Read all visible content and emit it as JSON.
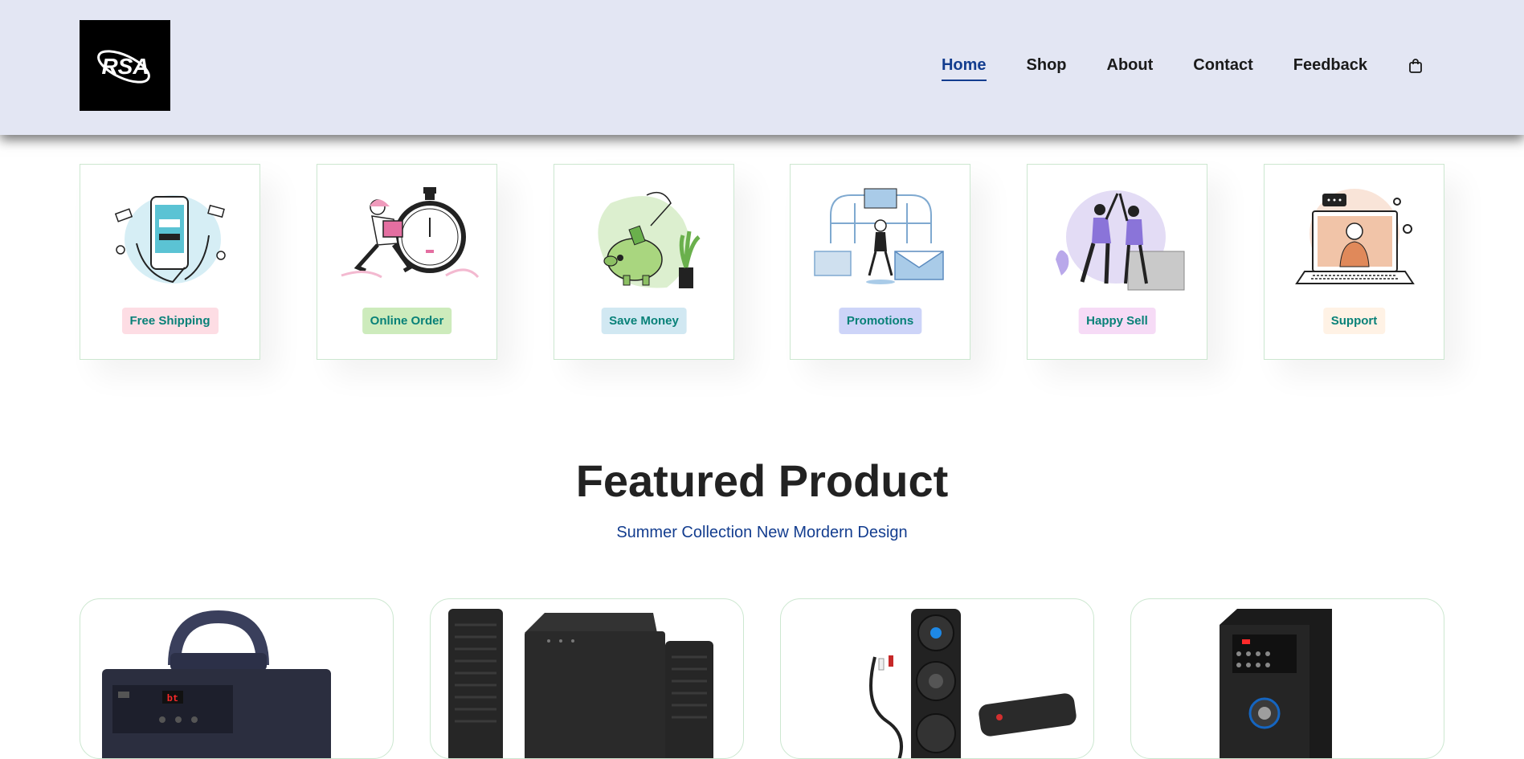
{
  "brand": {
    "logo_text": "RSA"
  },
  "nav": {
    "items": [
      {
        "label": "Home",
        "active": true
      },
      {
        "label": "Shop",
        "active": false
      },
      {
        "label": "About",
        "active": false
      },
      {
        "label": "Contact",
        "active": false
      },
      {
        "label": "Feedback",
        "active": false
      }
    ],
    "cart_icon": "shopping-bag-icon"
  },
  "features": [
    {
      "label": "Free Shipping",
      "tag_color": "#fddde4",
      "illustration": "phone-payment-illustration"
    },
    {
      "label": "Online Order",
      "tag_color": "#cdebbc",
      "illustration": "delivery-stopwatch-illustration"
    },
    {
      "label": "Save Money",
      "tag_color": "#d1e8f2",
      "illustration": "piggy-bank-illustration"
    },
    {
      "label": "Promotions",
      "tag_color": "#cdd4f8",
      "illustration": "promotions-illustration"
    },
    {
      "label": "Happy Sell",
      "tag_color": "#f6dbf6",
      "illustration": "high-five-illustration"
    },
    {
      "label": "Support",
      "tag_color": "#fff2e5",
      "illustration": "support-laptop-illustration"
    }
  ],
  "featured": {
    "title": "Featured Product",
    "subtitle": "Summer Collection New Mordern Design"
  },
  "products": [
    {
      "image": "portable-speaker-image"
    },
    {
      "image": "home-theater-speakers-image"
    },
    {
      "image": "tower-speaker-set-image"
    },
    {
      "image": "tower-speaker-image"
    }
  ],
  "colors": {
    "header_bg": "#e3e6f3",
    "accent": "#133d8f",
    "tag_text": "#088178",
    "border": "#cce7d0"
  }
}
